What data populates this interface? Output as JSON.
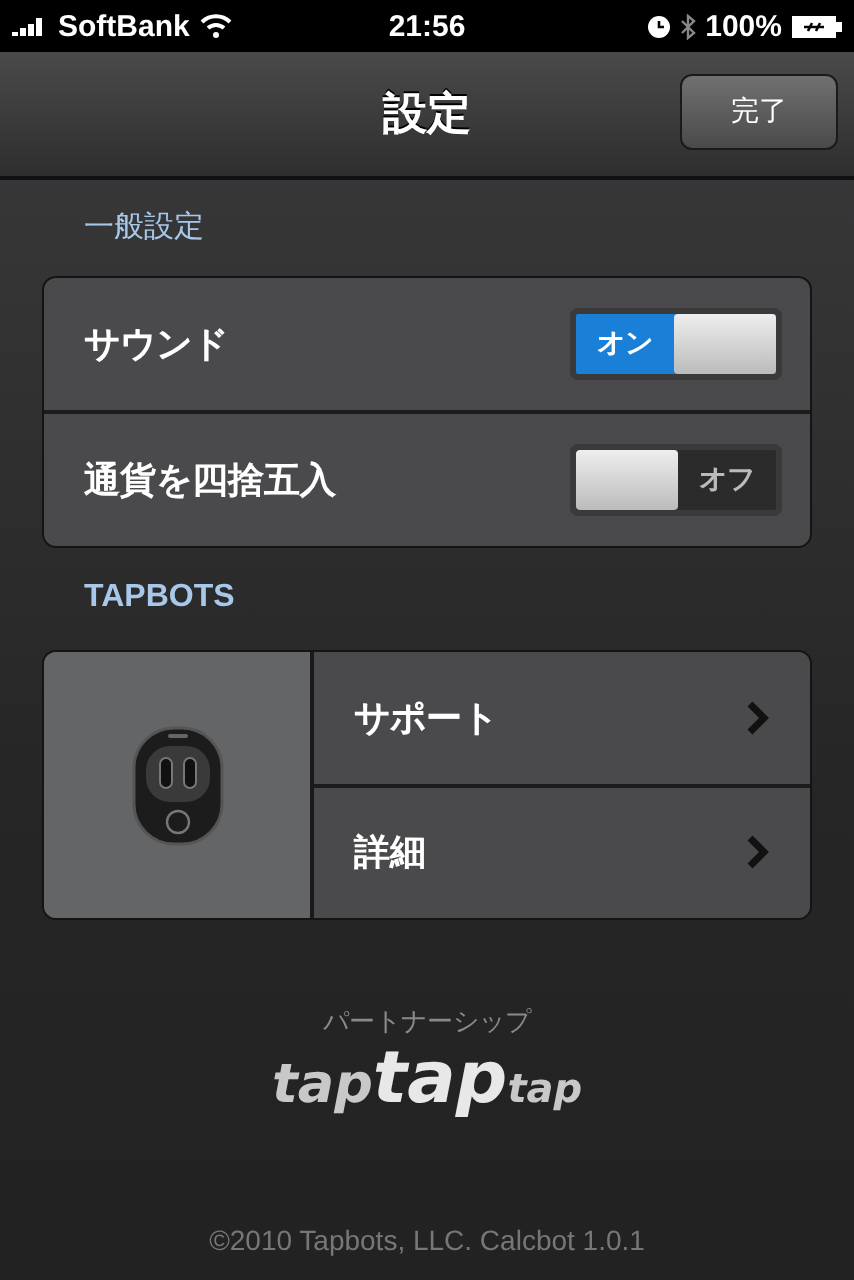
{
  "status_bar": {
    "carrier": "SoftBank",
    "time": "21:56",
    "battery": "100%"
  },
  "nav": {
    "title": "設定",
    "done_button": "完了"
  },
  "general": {
    "header": "一般設定",
    "rows": [
      {
        "label": "サウンド",
        "on": true,
        "switch_text": "オン"
      },
      {
        "label": "通貨を四捨五入",
        "on": false,
        "switch_text": "オフ"
      }
    ]
  },
  "tapbots": {
    "header": "TAPBOTS",
    "links": [
      {
        "label": "サポート"
      },
      {
        "label": "詳細"
      }
    ]
  },
  "partner": {
    "caption": "パートナーシップ",
    "logo": [
      "tap",
      "tap",
      "tap"
    ]
  },
  "footer": "©2010 Tapbots, LLC. Calcbot 1.0.1"
}
